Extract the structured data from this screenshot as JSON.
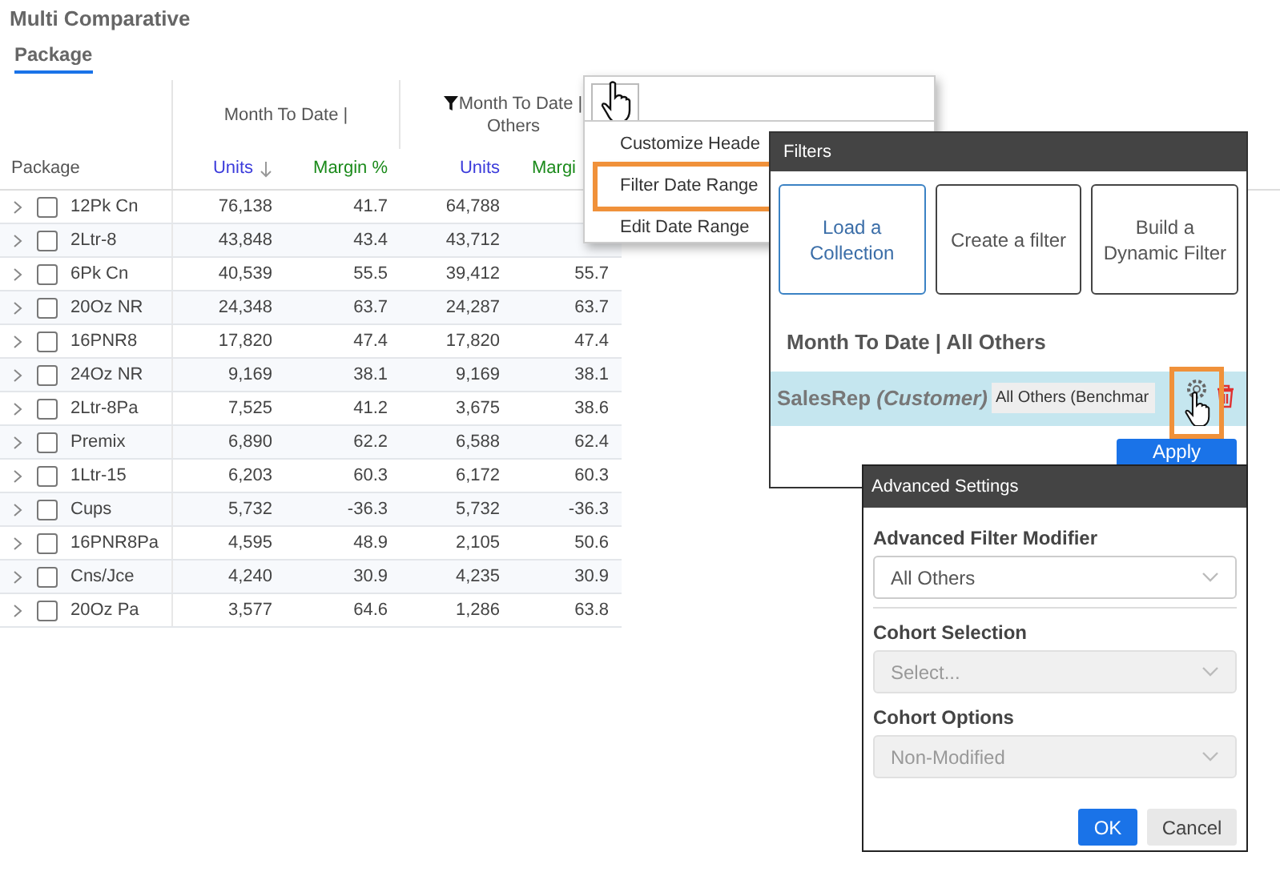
{
  "title": "Multi Comparative",
  "tabs": [
    {
      "label": "Package",
      "selected": true
    }
  ],
  "table": {
    "row_header": "Package",
    "groups": [
      {
        "label": "Month To Date |",
        "filtered": false
      },
      {
        "label": "Month To Date |",
        "line2": "Others",
        "filtered": true
      }
    ],
    "columns": [
      {
        "label": "Units",
        "color": "#3b3bdb",
        "sorted": true
      },
      {
        "label": "Margin %",
        "color": "#1a8a1a",
        "sorted": false
      },
      {
        "label": "Units",
        "color": "#3b3bdb",
        "sorted": false
      },
      {
        "label": "Margi",
        "color": "#1a8a1a",
        "sorted": false
      }
    ],
    "rows": [
      {
        "name": "12Pk Cn",
        "checked": false,
        "expanded": false,
        "cells": [
          "76,138",
          "41.7",
          "64,788",
          null
        ]
      },
      {
        "name": "2Ltr-8",
        "checked": false,
        "expanded": false,
        "cells": [
          "43,848",
          "43.4",
          "43,712",
          null
        ]
      },
      {
        "name": "6Pk Cn",
        "checked": false,
        "expanded": false,
        "cells": [
          "40,539",
          "55.5",
          "39,412",
          "55.7"
        ]
      },
      {
        "name": "20Oz NR",
        "checked": false,
        "expanded": false,
        "cells": [
          "24,348",
          "63.7",
          "24,287",
          "63.7"
        ]
      },
      {
        "name": "16PNR8",
        "checked": false,
        "expanded": false,
        "cells": [
          "17,820",
          "47.4",
          "17,820",
          "47.4"
        ]
      },
      {
        "name": "24Oz NR",
        "checked": false,
        "expanded": false,
        "cells": [
          "9,169",
          "38.1",
          "9,169",
          "38.1"
        ]
      },
      {
        "name": "2Ltr-8Pa",
        "checked": false,
        "expanded": false,
        "cells": [
          "7,525",
          "41.2",
          "3,675",
          "38.6"
        ]
      },
      {
        "name": "Premix",
        "checked": false,
        "expanded": false,
        "cells": [
          "6,890",
          "62.2",
          "6,588",
          "62.4"
        ]
      },
      {
        "name": "1Ltr-15",
        "checked": false,
        "expanded": false,
        "cells": [
          "6,203",
          "60.3",
          "6,172",
          "60.3"
        ]
      },
      {
        "name": "Cups",
        "checked": false,
        "expanded": false,
        "cells": [
          "5,732",
          "-36.3",
          "5,732",
          "-36.3"
        ]
      },
      {
        "name": "16PNR8Pa",
        "checked": false,
        "expanded": false,
        "cells": [
          "4,595",
          "48.9",
          "2,105",
          "50.6"
        ]
      },
      {
        "name": "Cns/Jce",
        "checked": false,
        "expanded": false,
        "cells": [
          "4,240",
          "30.9",
          "4,235",
          "30.9"
        ]
      },
      {
        "name": "20Oz Pa",
        "checked": false,
        "expanded": false,
        "cells": [
          "3,577",
          "64.6",
          "1,286",
          "63.8"
        ]
      }
    ]
  },
  "context_menu": {
    "items": [
      {
        "label": "Customize Heade",
        "highlighted": false
      },
      {
        "label": "Filter Date Range",
        "highlighted": true
      },
      {
        "label": "Edit Date Range",
        "highlighted": false
      }
    ]
  },
  "filters_dialog": {
    "title": "Filters",
    "buttons": [
      {
        "label": "Load a Collection",
        "selected": true
      },
      {
        "label": "Create a filter",
        "selected": false
      },
      {
        "label": "Build a Dynamic Filter",
        "selected": false
      }
    ],
    "section": "Month To Date | All Others",
    "filter_row": {
      "field": "SalesRep",
      "qualifier": "(Customer)",
      "value": "All Others (Benchmar"
    },
    "apply": "Apply"
  },
  "advanced_settings": {
    "title": "Advanced Settings",
    "fields": [
      {
        "label": "Advanced Filter Modifier",
        "value": "All Others",
        "disabled": false
      },
      {
        "label": "Cohort Selection",
        "placeholder": "Select...",
        "disabled": true
      },
      {
        "label": "Cohort Options",
        "value": "Non-Modified",
        "disabled": true
      }
    ],
    "ok": "OK",
    "cancel": "Cancel"
  }
}
